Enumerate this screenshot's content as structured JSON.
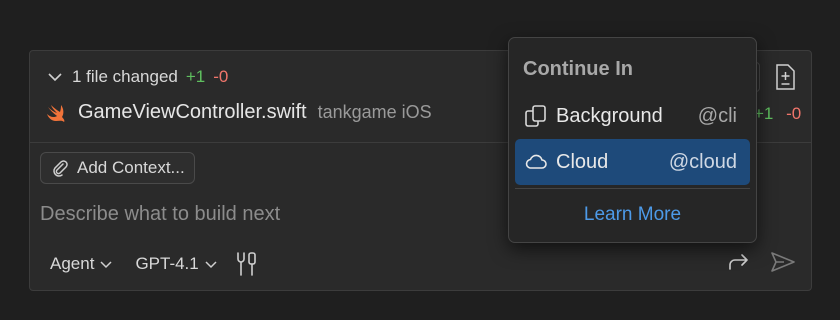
{
  "changes": {
    "summary": "1 file changed",
    "added": "+1",
    "removed": "-0",
    "file": {
      "name": "GameViewController.swift",
      "target": "tankgame iOS",
      "added": "+1",
      "removed": "-0",
      "icon": "swift-file-icon"
    }
  },
  "composer": {
    "add_context_label": "Add Context...",
    "prompt_placeholder": "Describe what to build next",
    "mode": "Agent",
    "model": "GPT-4.1"
  },
  "menu": {
    "title": "Continue In",
    "items": [
      {
        "label": "Background",
        "alias": "@cli",
        "icon": "copy-icon",
        "selected": false
      },
      {
        "label": "Cloud",
        "alias": "@cloud",
        "icon": "cloud-icon",
        "selected": true
      }
    ],
    "learn_more": "Learn More"
  },
  "colors": {
    "added": "#5fbf5f",
    "removed": "#f0756b",
    "selection": "#1e4a7a",
    "link": "#4d9ae8",
    "swift": "#f0733a"
  }
}
